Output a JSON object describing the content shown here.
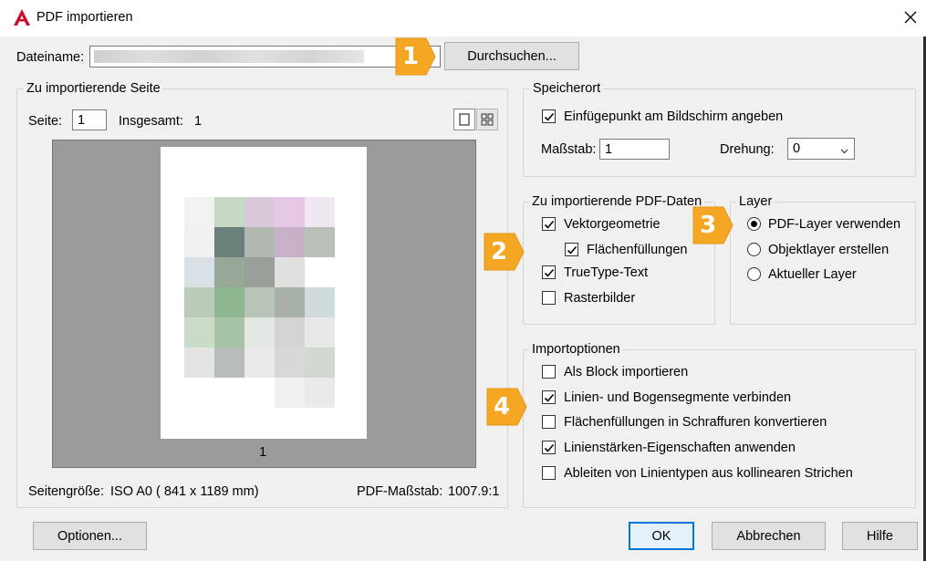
{
  "window": {
    "title": "PDF importieren",
    "logo_letter": "A"
  },
  "file": {
    "label": "Dateiname:",
    "browse_button": "Durchsuchen..."
  },
  "page_group": {
    "title": "Zu importierende Seite",
    "page_label": "Seite:",
    "page_value": "1",
    "total_label": "Insgesamt:",
    "total_value": "1",
    "preview_page_number": "1",
    "page_size_label": "Seitengröße:",
    "page_size_value": "ISO A0 ( 841 x  1189 mm)",
    "pdf_scale_label": "PDF-Maßstab:",
    "pdf_scale_value": "1007.9:1"
  },
  "location_group": {
    "title": "Speicherort",
    "insertion_checkbox": "Einfügepunkt am Bildschirm angeben",
    "insertion_checked": true,
    "scale_label": "Maßstab:",
    "scale_value": "1",
    "rotation_label": "Drehung:",
    "rotation_value": "0"
  },
  "pdf_data_group": {
    "title": "Zu importierende PDF-Daten",
    "items": [
      {
        "label": "Vektorgeometrie",
        "checked": true
      },
      {
        "label": "Flächenfüllungen",
        "checked": true
      },
      {
        "label": "TrueType-Text",
        "checked": true
      },
      {
        "label": "Rasterbilder",
        "checked": false
      }
    ]
  },
  "layer_group": {
    "title": "Layer",
    "options": [
      {
        "label": "PDF-Layer verwenden",
        "selected": true
      },
      {
        "label": "Objektlayer erstellen",
        "selected": false
      },
      {
        "label": "Aktueller Layer",
        "selected": false
      }
    ]
  },
  "import_options_group": {
    "title": "Importoptionen",
    "items": [
      {
        "label": "Als Block importieren",
        "checked": false
      },
      {
        "label": "Linien- und Bogensegmente verbinden",
        "checked": true
      },
      {
        "label": "Flächenfüllungen in Schraffuren konvertieren",
        "checked": false
      },
      {
        "label": "Linienstärken-Eigenschaften anwenden",
        "checked": true
      },
      {
        "label": "Ableiten von Linientypen aus kollinearen Strichen",
        "checked": false
      }
    ]
  },
  "badges": [
    "1",
    "2",
    "3",
    "4"
  ],
  "footer": {
    "options_button": "Optionen...",
    "ok_button": "OK",
    "cancel_button": "Abbrechen",
    "help_button": "Hilfe"
  },
  "icons": {
    "logo": "autocad-logo-icon",
    "close": "close-icon",
    "checkmark": "checkmark-icon",
    "dropdown": "chevron-down-icon",
    "single_page_view": "single-page-view-icon",
    "thumbnail_view": "thumbnail-grid-view-icon"
  },
  "colors": {
    "badge": "#f5a623",
    "logo": "#c8102e",
    "accent": "#0078d7"
  }
}
